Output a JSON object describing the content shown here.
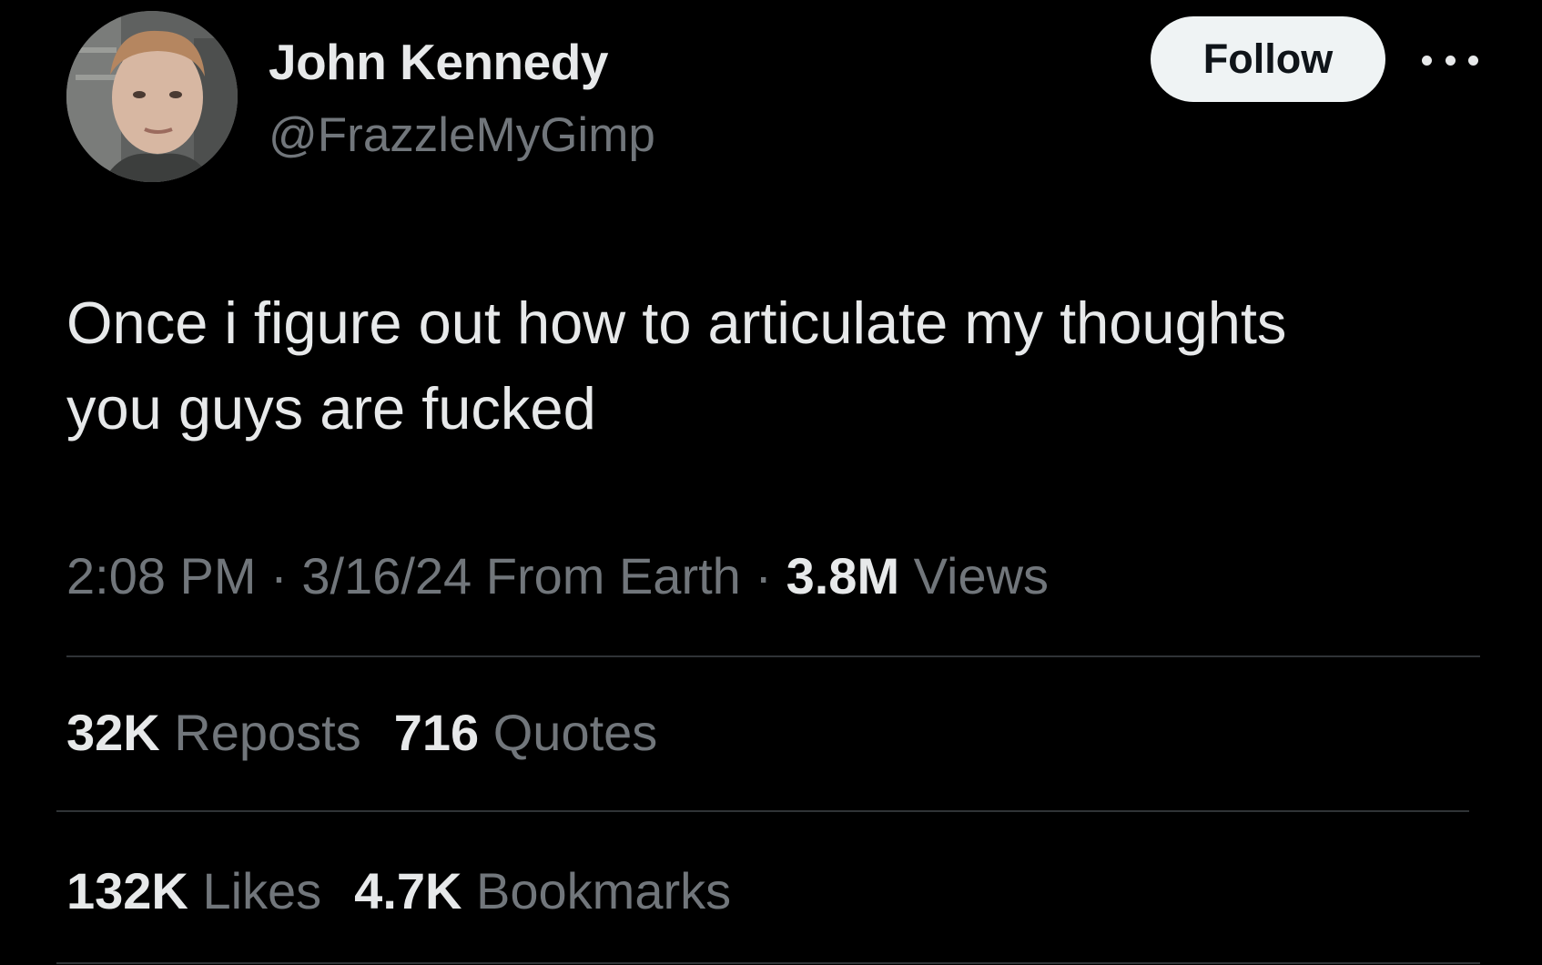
{
  "author": {
    "display_name": "John Kennedy",
    "handle": "@FrazzleMyGimp"
  },
  "actions": {
    "follow_label": "Follow",
    "more_icon": "more-horizontal-icon"
  },
  "tweet": {
    "text_line_1": "Once i figure out how to articulate my thoughts",
    "text_line_2": "you guys are fucked"
  },
  "meta": {
    "time": "2:08 PM",
    "separator": "·",
    "date": "3/16/24",
    "source": "From Earth",
    "views_count": "3.8M",
    "views_label": "Views"
  },
  "stats": {
    "reposts_count": "32K",
    "reposts_label": "Reposts",
    "quotes_count": "716",
    "quotes_label": "Quotes",
    "likes_count": "132K",
    "likes_label": "Likes",
    "bookmarks_count": "4.7K",
    "bookmarks_label": "Bookmarks"
  },
  "colors": {
    "background": "#000000",
    "primary_text": "#e7e9ea",
    "secondary_text": "#71767b",
    "divider": "#2f3336",
    "follow_button_bg": "#eff3f4"
  }
}
